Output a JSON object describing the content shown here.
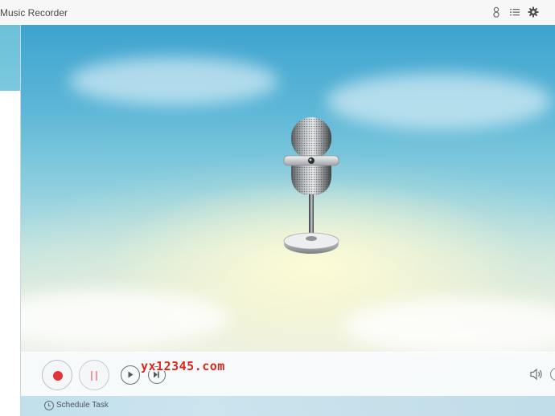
{
  "window": {
    "title": "Music Recorder",
    "header_icons": [
      "user-icon",
      "list-icon",
      "gear-icon"
    ]
  },
  "main": {
    "illustration": "microphone-icon"
  },
  "controls": {
    "buttons": [
      "record-icon",
      "pause-icon",
      "play-icon",
      "skip-next-icon",
      "volume-icon"
    ],
    "record_color": "#e2343b",
    "pause_color": "#f09aa0"
  },
  "schedule": {
    "label": "Schedule Task"
  },
  "watermark": {
    "text": "yx12345.com",
    "color": "#d9261c"
  },
  "colors": {
    "sidebar_active": "#6cc0d8",
    "sky_top": "#3ea3cf"
  }
}
